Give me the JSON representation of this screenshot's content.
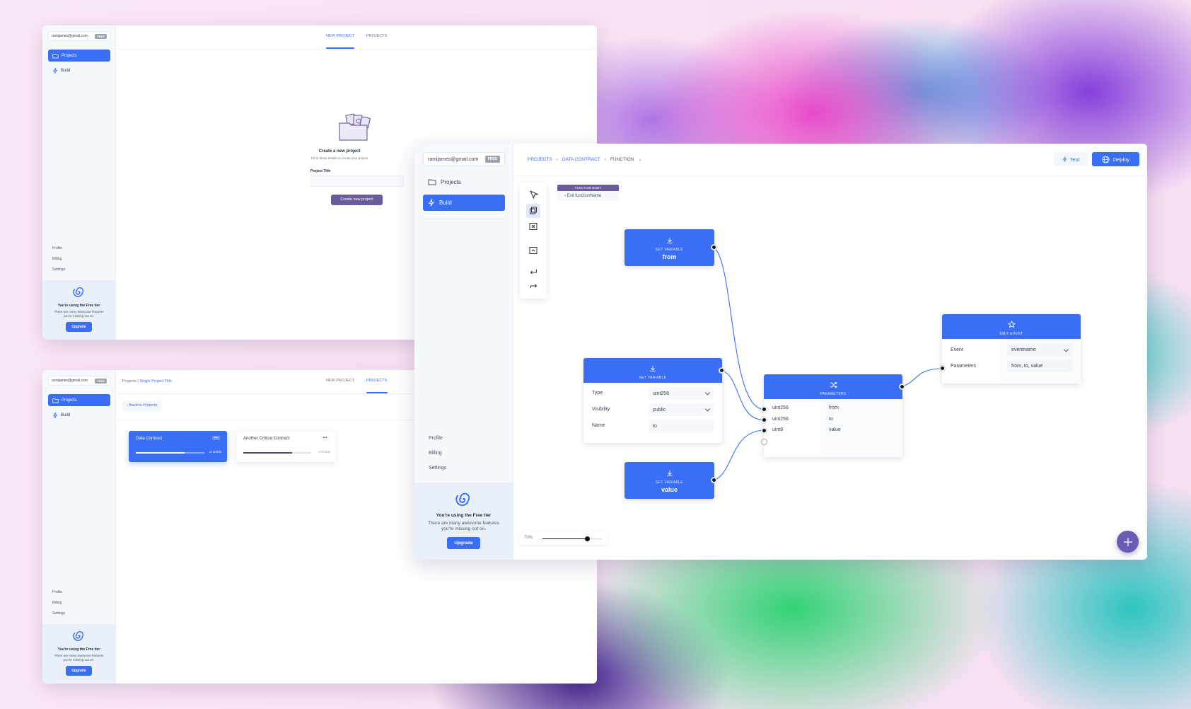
{
  "w1": {
    "email": "ramijames@gmail.com",
    "plan_badge": "FREE",
    "nav": [
      "Projects",
      "Build"
    ],
    "tabs": [
      "NEW PROJECT",
      "PROJECTS"
    ],
    "empty_title": "Create a new project",
    "empty_sub": "Fill in these details to create your project",
    "field_label": "Project Title",
    "field_value": "",
    "create_button": "Create new project",
    "footer_links": [
      "Profile",
      "Billing",
      "Settings"
    ],
    "promo_title": "You're using the Free tier",
    "promo_text": "There are many awesome features you're missing out on.",
    "upgrade_button": "Upgrade"
  },
  "w2": {
    "email": "ramijames@gmail.com",
    "plan_badge": "FREE",
    "nav": [
      "Projects",
      "Build"
    ],
    "crumb_root": "Projects",
    "crumb_sep": "|",
    "crumb_current": "Single Project Title",
    "tabs": [
      "NEW PROJECT",
      "PROJECTS"
    ],
    "back_button": "Back to Projects",
    "contracts": [
      {
        "name": "Data Contract",
        "more": "•••",
        "size": "17/24KB",
        "progress": 0.71
      },
      {
        "name": "Another Critical Contract",
        "more": "•••",
        "size": "17/24KB",
        "progress": 0.71
      }
    ],
    "footer_links": [
      "Profile",
      "Billing",
      "Settings"
    ],
    "promo_title": "You're using the Free tier",
    "promo_text": "There are many awesome features you're missing out on.",
    "upgrade_button": "Upgrade"
  },
  "w3": {
    "email": "ramijames@gmail.com",
    "plan_badge": "FREE",
    "nav": [
      "Projects",
      "Build"
    ],
    "breadcrumb": [
      "PROJECTS",
      "DATA CONTRACT",
      "FUNCTION"
    ],
    "test_button": "Test",
    "deploy_button": "Deploy",
    "function_body_label": "FUNCTION BODY",
    "exit_label": "Exit functionName",
    "node_from": {
      "sub": "SET VARIABLE",
      "name": "from"
    },
    "node_var": {
      "sub": "SET VARIABLE",
      "type_label": "Type",
      "type_value": "uint256",
      "visibility_label": "Visibility",
      "visibility_value": "public",
      "name_label": "Name",
      "name_value": "to"
    },
    "node_value": {
      "sub": "SET VARIABLE",
      "name": "value"
    },
    "node_params": {
      "sub": "PARAMETERS",
      "rows": [
        {
          "type": "uint256",
          "name": "from"
        },
        {
          "type": "uint256",
          "name": "to"
        },
        {
          "type": "uint8",
          "name": "value"
        }
      ]
    },
    "node_emit": {
      "sub": "EMIT EVENT",
      "event_label": "Event",
      "event_value": "eventname",
      "params_label": "Parameters",
      "params_value": "from, to, value"
    },
    "zoom": "70%",
    "zoom_level": 0.75,
    "footer_links": [
      "Profile",
      "Billing",
      "Settings"
    ],
    "promo_title": "You're using the Free tier",
    "promo_text": "There are many awesome features you're missing out on.",
    "upgrade_button": "Upgrade"
  },
  "colors": {
    "accent": "#3b6ef6",
    "purple_button": "#6b5b9a",
    "fab": "#6b5bb5"
  }
}
